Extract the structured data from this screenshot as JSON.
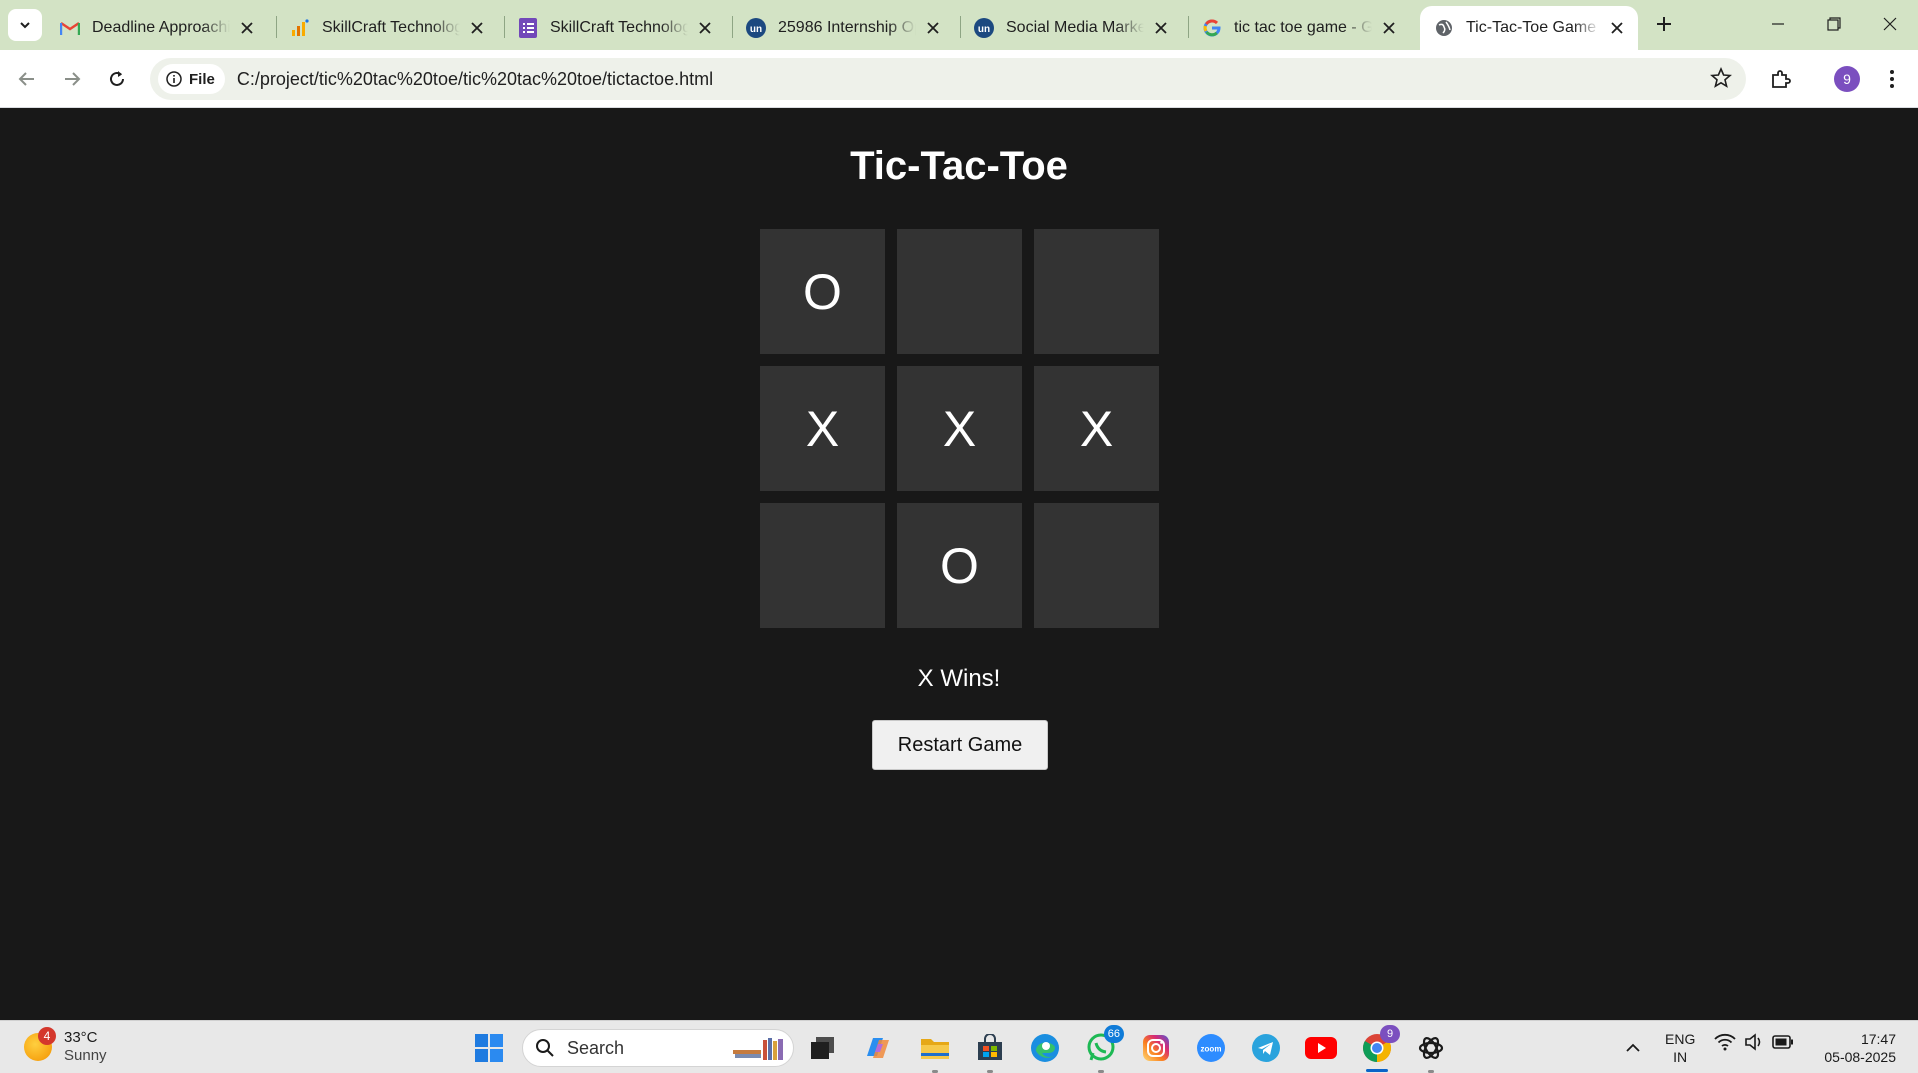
{
  "browser": {
    "tabs": [
      {
        "title": "Deadline Approaching",
        "icon": "gmail-icon"
      },
      {
        "title": "SkillCraft Technology",
        "icon": "analytics-icon"
      },
      {
        "title": "SkillCraft Technology",
        "icon": "forms-icon"
      },
      {
        "title": "25986 Internship Opportunities",
        "icon": "unstop-icon"
      },
      {
        "title": "Social Media Marketing",
        "icon": "unstop-icon"
      },
      {
        "title": "tic tac toe game - Google Search",
        "icon": "google-icon"
      },
      {
        "title": "Tic-Tac-Toe Game",
        "icon": "globe-icon",
        "active": true
      }
    ],
    "address": {
      "chip_label": "File",
      "url": "C:/project/tic%20tac%20toe/tic%20tac%20toe/tictactoe.html"
    },
    "profile_initial": "9"
  },
  "game": {
    "title": "Tic-Tac-Toe",
    "board": [
      "O",
      "",
      "",
      "X",
      "X",
      "X",
      "",
      "O",
      ""
    ],
    "status": "X Wins!",
    "restart_label": "Restart Game"
  },
  "taskbar": {
    "weather": {
      "temp": "33°C",
      "condition": "Sunny",
      "badge": "4"
    },
    "search_placeholder": "Search",
    "whatsapp_badge": "66",
    "chrome_badge": "9",
    "language": {
      "line1": "ENG",
      "line2": "IN"
    },
    "clock": {
      "time": "17:47",
      "date": "05-08-2025"
    }
  },
  "colors": {
    "page_background": "#181818",
    "cell_background": "#333333",
    "tabstrip": "#d3e3c5"
  }
}
